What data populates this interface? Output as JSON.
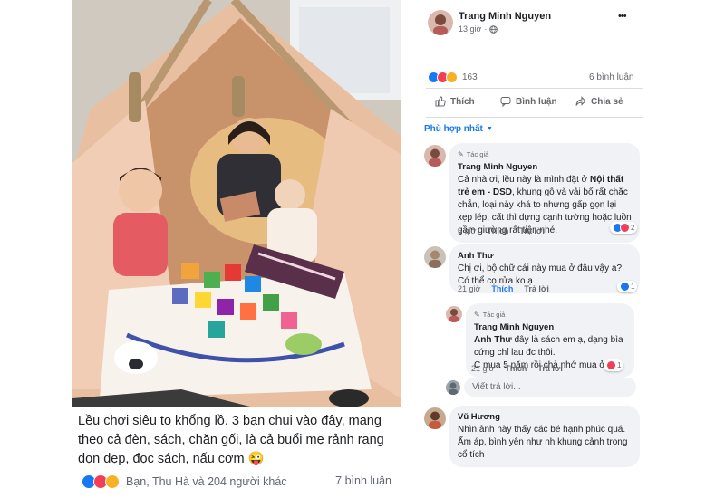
{
  "post": {
    "caption": "Lều chơi siêu to khổng lồ. 3 bạn chui vào đây, mang theo cả đèn, sách, chăn gối, là cả buổi mẹ rảnh rang dọn dẹp, đọc sách, nấu cơm 😜",
    "reactions_text": "Bạn, Thu Hà và 204 người khác",
    "comments_text": "7 bình luận",
    "photo_icon": "tent-photo"
  },
  "header": {
    "author": "Trang Minh Nguyen",
    "time": "13 giờ",
    "more_label": "•••"
  },
  "stats": {
    "reaction_count": "163",
    "comment_count": "6 bình luận"
  },
  "actions": {
    "like": "Thích",
    "comment": "Bình luận",
    "share": "Chia sẻ"
  },
  "sort": {
    "label": "Phù hợp nhất"
  },
  "comments": [
    {
      "author_tag": "Tác giả",
      "name": "Trang Minh Nguyen",
      "text_pre": "Cả nhà ơi, lều này là mình đặt ở ",
      "text_bold": "Nội thất trẻ em - DSD",
      "text_post": ", khung gỗ và vải bố rất chắc chắn, loại này khá to nhưng gấp gọn lại xẹp lép, cất thì dựng cạnh tường hoặc luồn gầm giường rất tiện nhé.",
      "time": "6 giờ",
      "like": "Thích",
      "reply": "Trả lời",
      "reaction_count": "2"
    },
    {
      "name": "Anh Thư",
      "text": "Chị ơi, bộ chữ cái này mua ở đâu vậy ạ? Có thể cọ rửa ko ạ",
      "time": "21 giờ",
      "like": "Thích",
      "reply": "Trả lời",
      "reaction_count": "1"
    },
    {
      "author_tag": "Tác giả",
      "name": "Trang Minh Nguyen",
      "mention": "Anh Thư",
      "text_post": " đây là sách em ạ, dạng bìa cứng chỉ lau đc thôi.",
      "text_line2": "C mua 5 năm rồi chả nhớ mua ở đâu",
      "time": "21 giờ",
      "like": "Thích",
      "reply": "Trả lời",
      "reaction_count": "1"
    },
    {
      "name": "Vũ Hương",
      "text": "Nhìn ảnh này thấy các bé hạnh phúc quá. Ấm áp, bình yên như nh khung cảnh trong cổ tích"
    }
  ],
  "reply_input": {
    "placeholder": "Viết trả lời..."
  },
  "colors": {
    "accent": "#1877f2",
    "like": "#1877f2",
    "love": "#f33e58",
    "haha": "#f7b125"
  }
}
